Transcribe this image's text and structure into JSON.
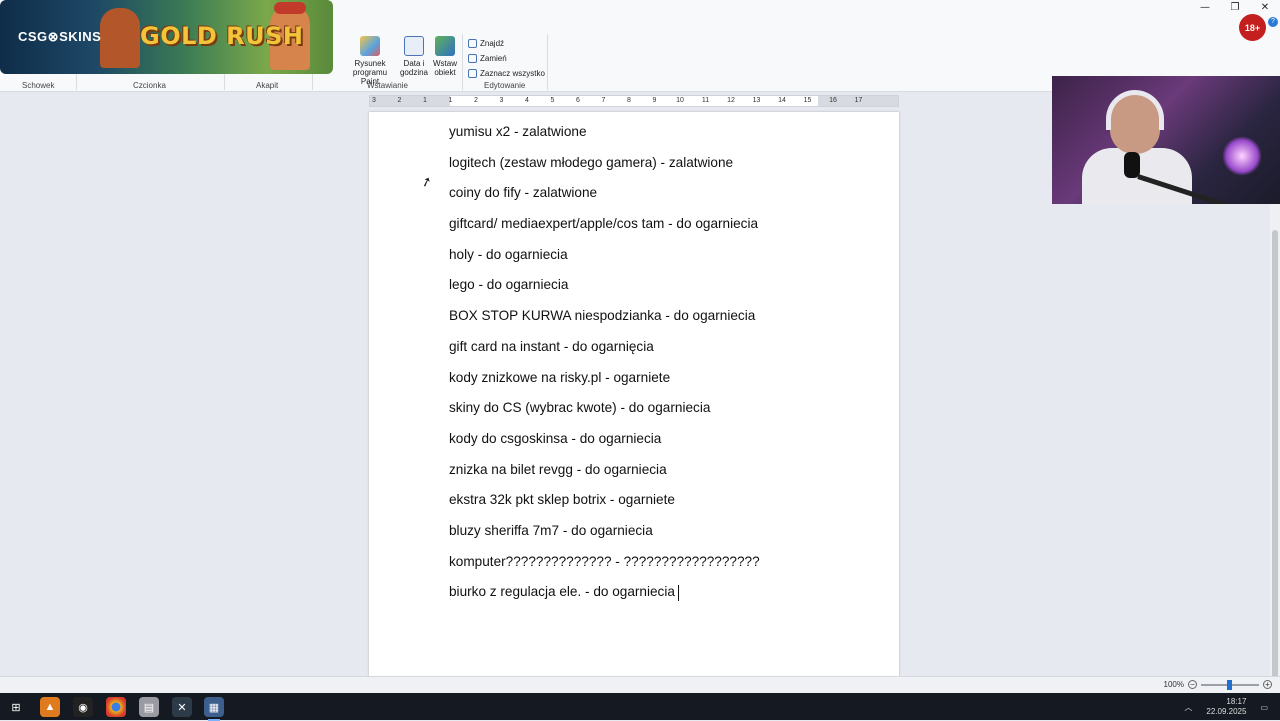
{
  "ribbon": {
    "groups": [
      "Schowek",
      "Czcionka",
      "Akapit",
      "Wstawianie",
      "Edytowanie"
    ],
    "insert_buttons": [
      {
        "label": "Rysunek programu Paint",
        "icon": "paint-icon"
      },
      {
        "label": "Data i godzina",
        "icon": "calendar-icon"
      },
      {
        "label": "Wstaw obiekt",
        "icon": "insert-object-icon"
      }
    ],
    "edit_items": [
      {
        "label": "Znajdź",
        "icon": "binoculars-icon"
      },
      {
        "label": "Zamień",
        "icon": "replace-icon"
      },
      {
        "label": "Zaznacz wszystko",
        "icon": "select-all-icon"
      }
    ]
  },
  "overlay": {
    "brand": "CSG⊗SKINS",
    "game_title": "GOLD RUSH",
    "age_badge": "18+"
  },
  "ruler": {
    "numbers": [
      "3",
      "2",
      "1",
      "1",
      "2",
      "3",
      "4",
      "5",
      "6",
      "7",
      "8",
      "9",
      "10",
      "11",
      "12",
      "13",
      "14",
      "15",
      "16",
      "17"
    ]
  },
  "document": {
    "lines": [
      "yumisu x2 - zalatwione",
      "logitech (zestaw młodego gamera) - zalatwione",
      "coiny do fify - zalatwione",
      "giftcard/ mediaexpert/apple/cos tam - do ogarniecia",
      "holy - do ogarniecia",
      "lego - do ogarniecia",
      "BOX STOP KURWA niespodzianka - do ogarniecia",
      "gift card na instant - do ogarnięcia",
      "kody znizkowe na risky.pl - ogarniete",
      "skiny do CS (wybrac kwote) - do ogarniecia",
      "kody do csgoskinsa - do ogarniecia",
      "znizka na bilet revgg - do ogarniecia",
      "ekstra 32k pkt sklep botrix - ogarniete",
      "bluzy sheriffa 7m7 - do ogarniecia",
      "komputer?????????????? - ??????????????????",
      "biurko z regulacja ele. - do ogarniecia"
    ]
  },
  "status": {
    "zoom": "100%",
    "zoom_level_fraction": 0.5
  },
  "taskbar": {
    "time": "18:17",
    "date": "22.09.2025"
  },
  "colors": {
    "accent": "#1f6fd1",
    "taskbar": "#151a22",
    "badge": "#c41f1f"
  }
}
